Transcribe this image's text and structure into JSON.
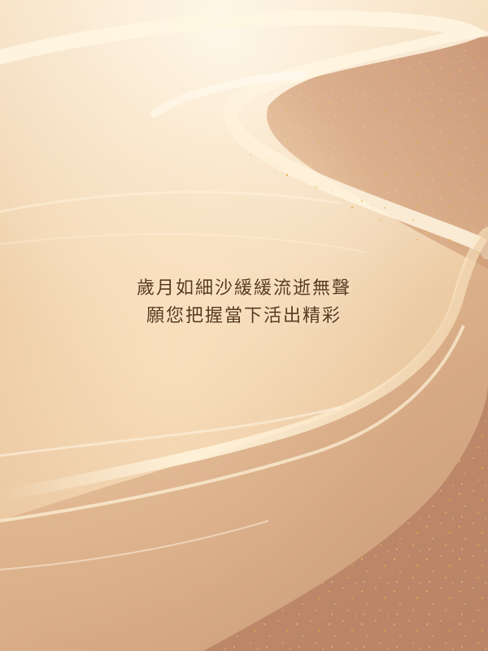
{
  "quote": {
    "line1": "歲月如細沙緩緩流逝無聲",
    "line2": "願您把握當下活出精彩"
  },
  "palette": {
    "sand_light": "#fbecd0",
    "sand_mid": "#ecc79a",
    "sand_shadow": "#cf9b78",
    "dune_dark": "#b88466",
    "sparkle": "#e0a540",
    "text": "#5a3a1f"
  }
}
